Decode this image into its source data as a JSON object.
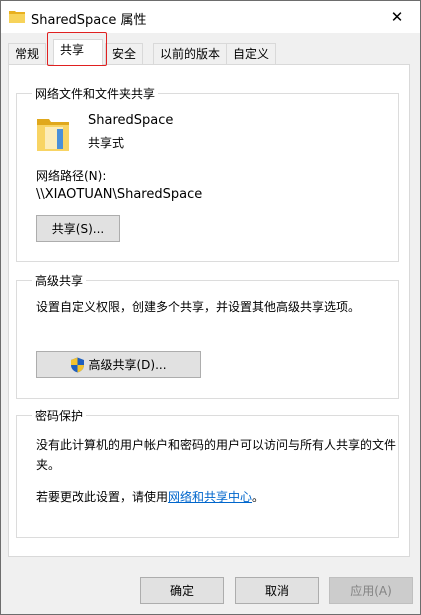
{
  "window": {
    "title": "SharedSpace 属性",
    "close_symbol": "✕"
  },
  "tabs": [
    {
      "label": "常规"
    },
    {
      "label": "共享"
    },
    {
      "label": "安全"
    },
    {
      "label": "以前的版本"
    },
    {
      "label": "自定义"
    }
  ],
  "active_tab": "共享",
  "network_group": {
    "title": "网络文件和文件夹共享",
    "folder_name": "SharedSpace",
    "share_status": "共享式",
    "path_label": "网络路径(N):",
    "path_value": "\\\\XIAOTUAN\\SharedSpace",
    "share_button": "共享(S)..."
  },
  "advanced_group": {
    "title": "高级共享",
    "description": "设置自定义权限，创建多个共享，并设置其他高级共享选项。",
    "button": "高级共享(D)..."
  },
  "password_group": {
    "title": "密码保护",
    "description_line1": "没有此计算机的用户帐户和密码的用户可以访问与所有人共享的文件",
    "description_line2": "夹。",
    "change_prefix": "若要更改此设置，请使用",
    "change_link": "网络和共享中心",
    "change_suffix": "。"
  },
  "footer": {
    "ok": "确定",
    "cancel": "取消",
    "apply": "应用(A)"
  },
  "colors": {
    "accent_highlight": "#e02020",
    "link": "#0066cc",
    "folder": "#f4c343"
  }
}
